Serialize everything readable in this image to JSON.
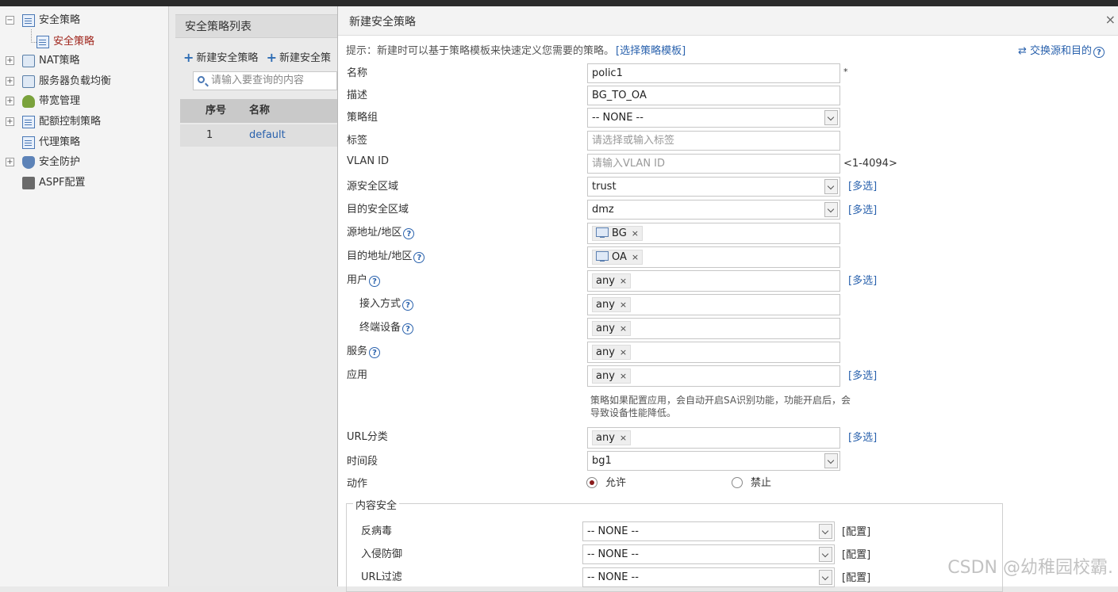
{
  "nav": {
    "items": [
      {
        "label": "安全策略",
        "toggle": "−"
      },
      {
        "label": "安全策略"
      },
      {
        "label": "NAT策略",
        "toggle": "+"
      },
      {
        "label": "服务器负载均衡",
        "toggle": "+"
      },
      {
        "label": "带宽管理",
        "toggle": "+"
      },
      {
        "label": "配额控制策略",
        "toggle": "+"
      },
      {
        "label": "代理策略"
      },
      {
        "label": "安全防护",
        "toggle": "+"
      },
      {
        "label": "ASPF配置"
      }
    ]
  },
  "list": {
    "title": "安全策略列表",
    "new_label": "新建安全策略",
    "new_from_label": "新建安全策",
    "search_placeholder": "请输入要查询的内容",
    "columns": [
      "序号",
      "名称"
    ],
    "rows": [
      {
        "index": "1",
        "name": "default"
      }
    ]
  },
  "dialog": {
    "title": "新建安全策略",
    "close": "×",
    "hint": "提示：新建时可以基于策略模板来快速定义您需要的策略。",
    "hint_link": "[选择策略模板]",
    "switch_label": "交换源和目的",
    "qm": "?",
    "fields": {
      "name": {
        "label": "名称",
        "value": "polic1",
        "required": "*"
      },
      "desc": {
        "label": "描述",
        "value": "BG_TO_OA"
      },
      "group": {
        "label": "策略组",
        "value": "-- NONE --"
      },
      "tag": {
        "label": "标签",
        "placeholder": "请选择或输入标签"
      },
      "vlan": {
        "label": "VLAN ID",
        "placeholder": "请输入VLAN ID",
        "range": "<1-4094>"
      },
      "src_zone": {
        "label": "源安全区域",
        "value": "trust"
      },
      "dst_zone": {
        "label": "目的安全区域",
        "value": "dmz"
      },
      "src_addr": {
        "label": "源地址/地区",
        "tag": "BG"
      },
      "dst_addr": {
        "label": "目的地址/地区",
        "tag": "OA"
      },
      "user": {
        "label": "用户",
        "tag": "any"
      },
      "access": {
        "label": "接入方式",
        "tag": "any"
      },
      "terminal": {
        "label": "终端设备",
        "tag": "any"
      },
      "service": {
        "label": "服务",
        "tag": "any"
      },
      "app": {
        "label": "应用",
        "tag": "any"
      },
      "url": {
        "label": "URL分类",
        "tag": "any"
      },
      "time": {
        "label": "时间段",
        "value": "bg1"
      },
      "action": {
        "label": "动作",
        "allow": "允许",
        "deny": "禁止"
      }
    },
    "app_note": "策略如果配置应用，会自动开启SA识别功能，功能开启后，会导致设备性能降低。",
    "multi_label": "[多选]",
    "tag_remove": "×",
    "content_security": {
      "legend": "内容安全",
      "rows": [
        {
          "label": "反病毒",
          "value": "-- NONE --",
          "config": "[配置]"
        },
        {
          "label": "入侵防御",
          "value": "-- NONE --",
          "config": "[配置]"
        },
        {
          "label": "URL过滤",
          "value": "-- NONE --",
          "config": "[配置]"
        }
      ]
    }
  },
  "watermark": "CSDN @幼稚园校霸."
}
